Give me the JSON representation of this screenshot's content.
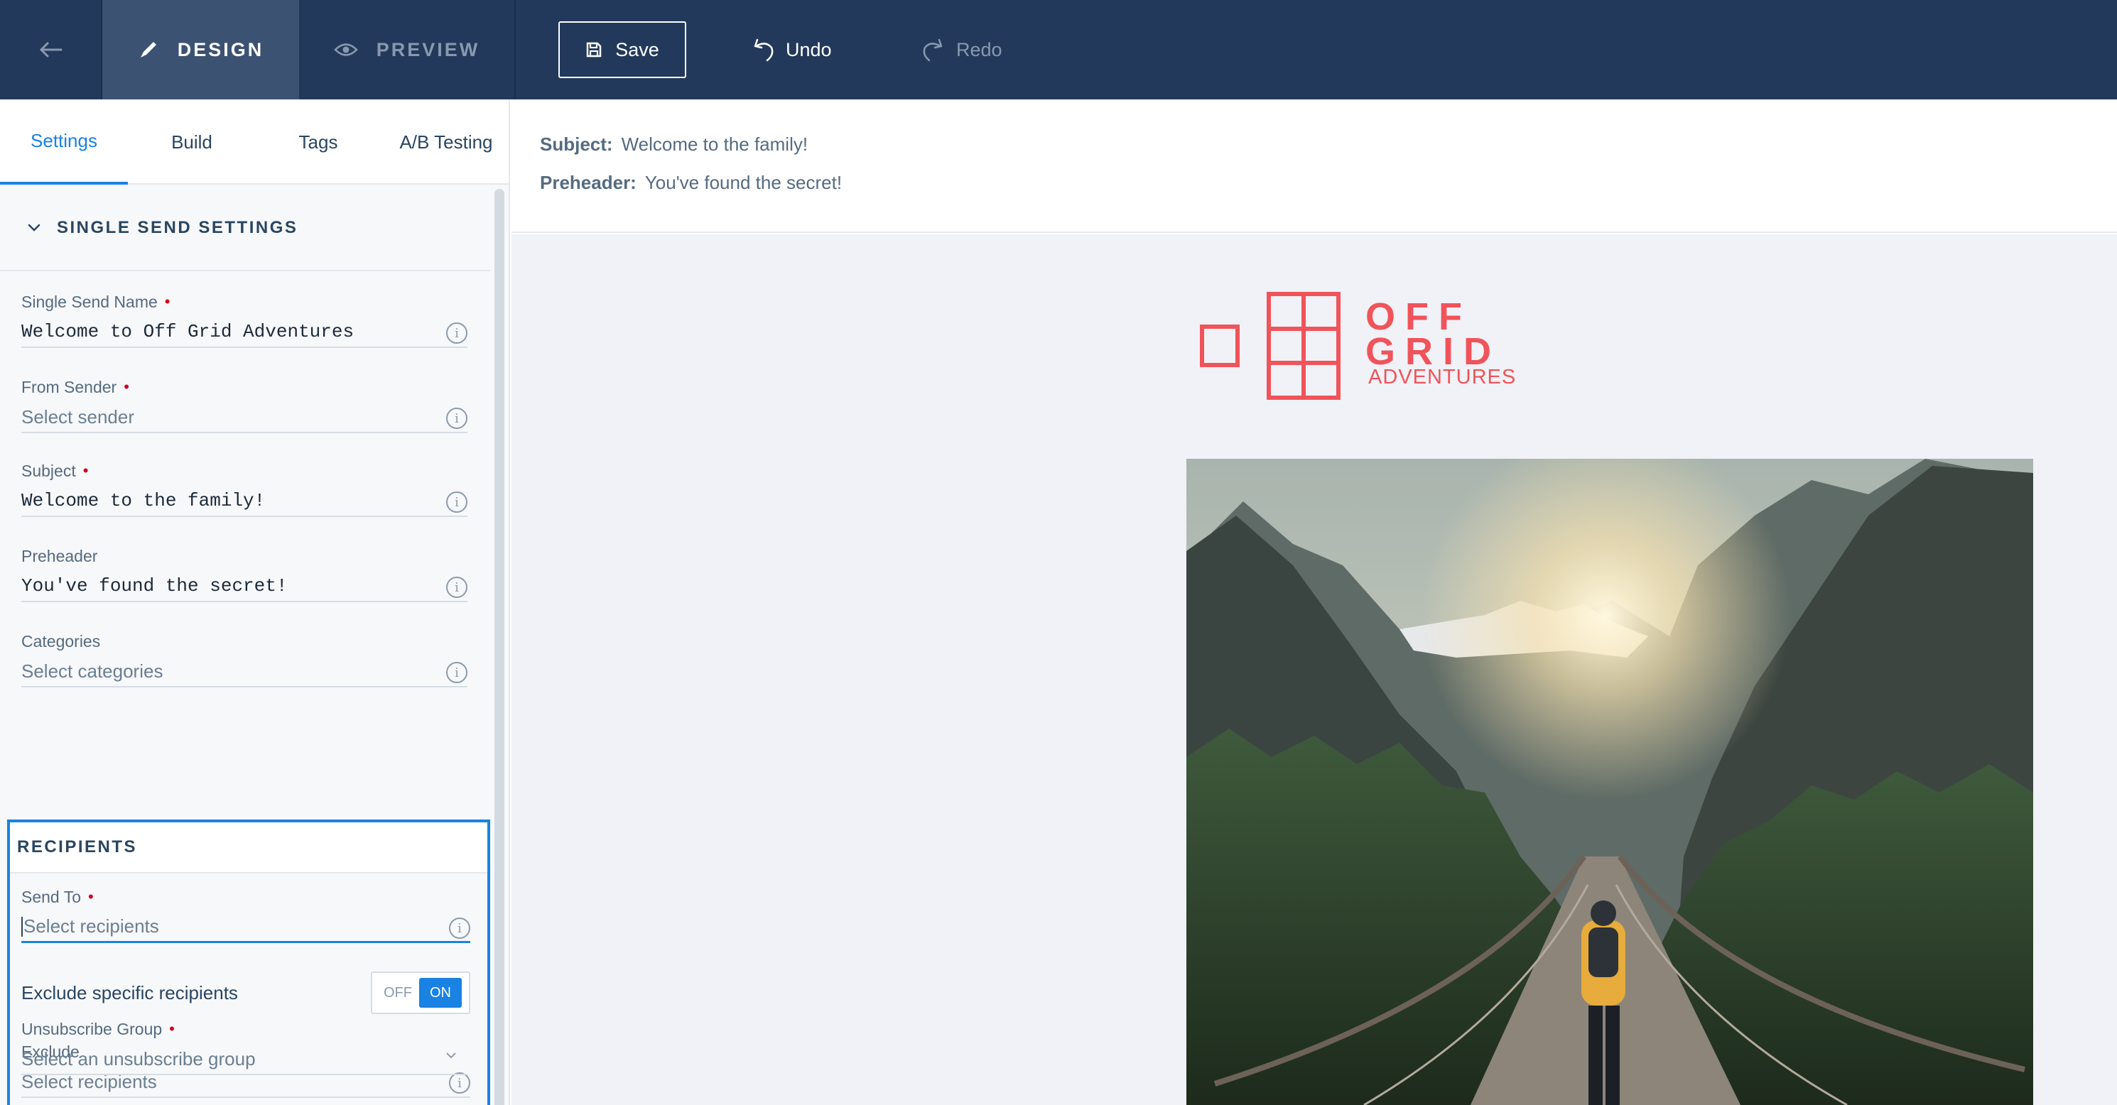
{
  "topbar": {
    "modes": [
      {
        "label": "DESIGN",
        "icon": "pencil-icon",
        "active": true
      },
      {
        "label": "PREVIEW",
        "icon": "eye-icon",
        "active": false
      }
    ],
    "save_label": "Save",
    "undo_label": "Undo",
    "redo_label": "Redo"
  },
  "tabs": [
    {
      "label": "Settings",
      "active": true
    },
    {
      "label": "Build",
      "active": false
    },
    {
      "label": "Tags",
      "active": false
    },
    {
      "label": "A/B Testing",
      "active": false
    }
  ],
  "settings": {
    "section_title": "SINGLE SEND SETTINGS",
    "name": {
      "label": "Single Send Name",
      "value": "Welcome to Off Grid Adventures"
    },
    "sender": {
      "label": "From Sender",
      "placeholder": "Select sender"
    },
    "subject": {
      "label": "Subject",
      "value": "Welcome to the family!"
    },
    "preheader": {
      "label": "Preheader",
      "value": "You've found the secret!"
    },
    "categories": {
      "label": "Categories",
      "placeholder": "Select categories"
    }
  },
  "recipients": {
    "section_title": "RECIPIENTS",
    "send_to": {
      "label": "Send To",
      "placeholder": "Select recipients"
    },
    "exclude_toggle": {
      "label": "Exclude specific recipients",
      "off_label": "OFF",
      "on_label": "ON",
      "state": "ON"
    },
    "exclude": {
      "label": "Exclude",
      "placeholder": "Select recipients"
    }
  },
  "unsubscribe": {
    "label": "Unsubscribe Group",
    "placeholder": "Select an unsubscribe group"
  },
  "preview": {
    "subject_label": "Subject:",
    "subject_value": "Welcome to the family!",
    "preheader_label": "Preheader:",
    "preheader_value": "You've found the secret!"
  },
  "email": {
    "logo_line1": "OFF",
    "logo_line2": "GRID",
    "logo_line3": "ADVENTURES",
    "hero_alt": "hiker-on-suspension-bridge-photo"
  },
  "colors": {
    "topbar": "#23395b",
    "accent": "#1a82e2",
    "brand": "#f0545a",
    "required": "#d0021b"
  }
}
